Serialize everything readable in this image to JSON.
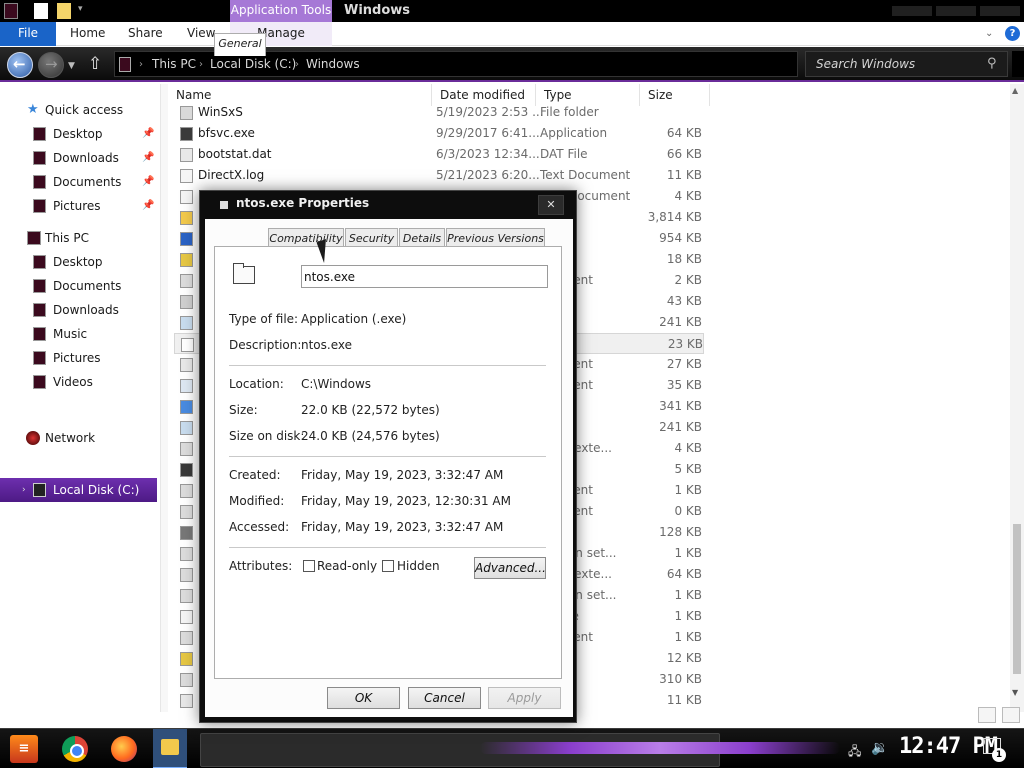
{
  "window": {
    "title": "Windows",
    "context_tab": "Application Tools"
  },
  "ribbon": {
    "file": "File",
    "home": "Home",
    "share": "Share",
    "view": "View",
    "manage": "Manage",
    "help": "?"
  },
  "address": {
    "crumbs": [
      "This PC",
      "Local Disk (C:)",
      "Windows"
    ],
    "search_placeholder": "Search Windows"
  },
  "nav": {
    "quick_access": "Quick access",
    "qa_items": [
      "Desktop",
      "Downloads",
      "Documents",
      "Pictures"
    ],
    "this_pc": "This PC",
    "pc_items": [
      "Desktop",
      "Documents",
      "Downloads",
      "Music",
      "Pictures",
      "Videos",
      "Local Disk (C:)"
    ],
    "network": "Network"
  },
  "columns": {
    "name": "Name",
    "date": "Date modified",
    "type": "Type",
    "size": "Size"
  },
  "files": [
    {
      "name": "WinSxS",
      "date": "5/19/2023 2:53 ...",
      "type": "File folder",
      "size": ""
    },
    {
      "name": "bfsvc.exe",
      "date": "9/29/2017 6:41...",
      "type": "Application",
      "size": "64 KB"
    },
    {
      "name": "bootstat.dat",
      "date": "6/3/2023 12:34...",
      "type": "DAT File",
      "size": "66 KB"
    },
    {
      "name": "DirectX.log",
      "date": "5/21/2023 6:20...",
      "type": "Text Document",
      "size": "11 KB"
    },
    {
      "name": "DtcInstall.log",
      "date": "5/19/2023 1:27...",
      "type": "Text Document",
      "size": "4 KB"
    },
    {
      "name": "",
      "date": "",
      "type": "ation",
      "size": "3,814 KB"
    },
    {
      "name": "",
      "date": "",
      "type": "ation",
      "size": "954 KB"
    },
    {
      "name": "",
      "date": "",
      "type": "ation",
      "size": "18 KB"
    },
    {
      "name": "",
      "date": "",
      "type": "ocument",
      "size": "2 KB"
    },
    {
      "name": "",
      "date": "",
      "type": "",
      "size": "43 KB"
    },
    {
      "name": "",
      "date": "",
      "type": "ation",
      "size": "241 KB"
    },
    {
      "name": "",
      "date": "",
      "type": "ation",
      "size": "23 KB"
    },
    {
      "name": "",
      "date": "",
      "type": "ocument",
      "size": "27 KB"
    },
    {
      "name": "",
      "date": "",
      "type": "ocument",
      "size": "35 KB"
    },
    {
      "name": "",
      "date": "",
      "type": "ation",
      "size": "341 KB"
    },
    {
      "name": "",
      "date": "",
      "type": "ation",
      "size": "241 KB"
    },
    {
      "name": "",
      "date": "",
      "type": "ation exte...",
      "size": "4 KB"
    },
    {
      "name": "",
      "date": "",
      "type": "ation",
      "size": "5 KB"
    },
    {
      "name": "",
      "date": "",
      "type": "ocument",
      "size": "1 KB"
    },
    {
      "name": "",
      "date": "",
      "type": "ocument",
      "size": "0 KB"
    },
    {
      "name": "",
      "date": "",
      "type": "ation",
      "size": "128 KB"
    },
    {
      "name": "",
      "date": "",
      "type": "uration set...",
      "size": "1 KB"
    },
    {
      "name": "",
      "date": "",
      "type": "ation exte...",
      "size": "64 KB"
    },
    {
      "name": "",
      "date": "",
      "type": "uration set...",
      "size": "1 KB"
    },
    {
      "name": "",
      "date": "",
      "type": "ST File",
      "size": "1 KB"
    },
    {
      "name": "",
      "date": "",
      "type": "ocument",
      "size": "1 KB"
    },
    {
      "name": "",
      "date": "",
      "type": "ation",
      "size": "12 KB"
    },
    {
      "name": "",
      "date": "",
      "type": "",
      "size": "310 KB"
    },
    {
      "name": "",
      "date": "",
      "type": "ation",
      "size": "11 KB"
    }
  ],
  "dialog": {
    "title": "ntos.exe Properties",
    "close": "✕",
    "tabs": [
      "General",
      "Compatibility",
      "Security",
      "Details",
      "Previous Versions"
    ],
    "filename": "ntos.exe",
    "type_label": "Type of file:",
    "type_value": "Application (.exe)",
    "desc_label": "Description:",
    "desc_value": "ntos.exe",
    "location_label": "Location:",
    "location_value": "C:\\Windows",
    "size_label": "Size:",
    "size_value": "22.0 KB (22,572 bytes)",
    "sod_label": "Size on disk:",
    "sod_value": "24.0 KB (24,576 bytes)",
    "created_label": "Created:",
    "created_value": "Friday, May 19, 2023, 3:32:47 AM",
    "modified_label": "Modified:",
    "modified_value": "Friday, May 19, 2023, 12:30:31 AM",
    "accessed_label": "Accessed:",
    "accessed_value": "Friday, May 19, 2023, 3:32:47 AM",
    "attributes_label": "Attributes:",
    "readonly_label": "Read-only",
    "hidden_label": "Hidden",
    "advanced": "Advanced...",
    "ok": "OK",
    "cancel": "Cancel",
    "apply": "Apply"
  },
  "taskbar": {
    "clock": "12:47 PM",
    "notification_count": "1"
  },
  "colors": {
    "accent": "#6a2c99",
    "file_tab": "#1a64c8",
    "context_tab": "#a678d6"
  }
}
